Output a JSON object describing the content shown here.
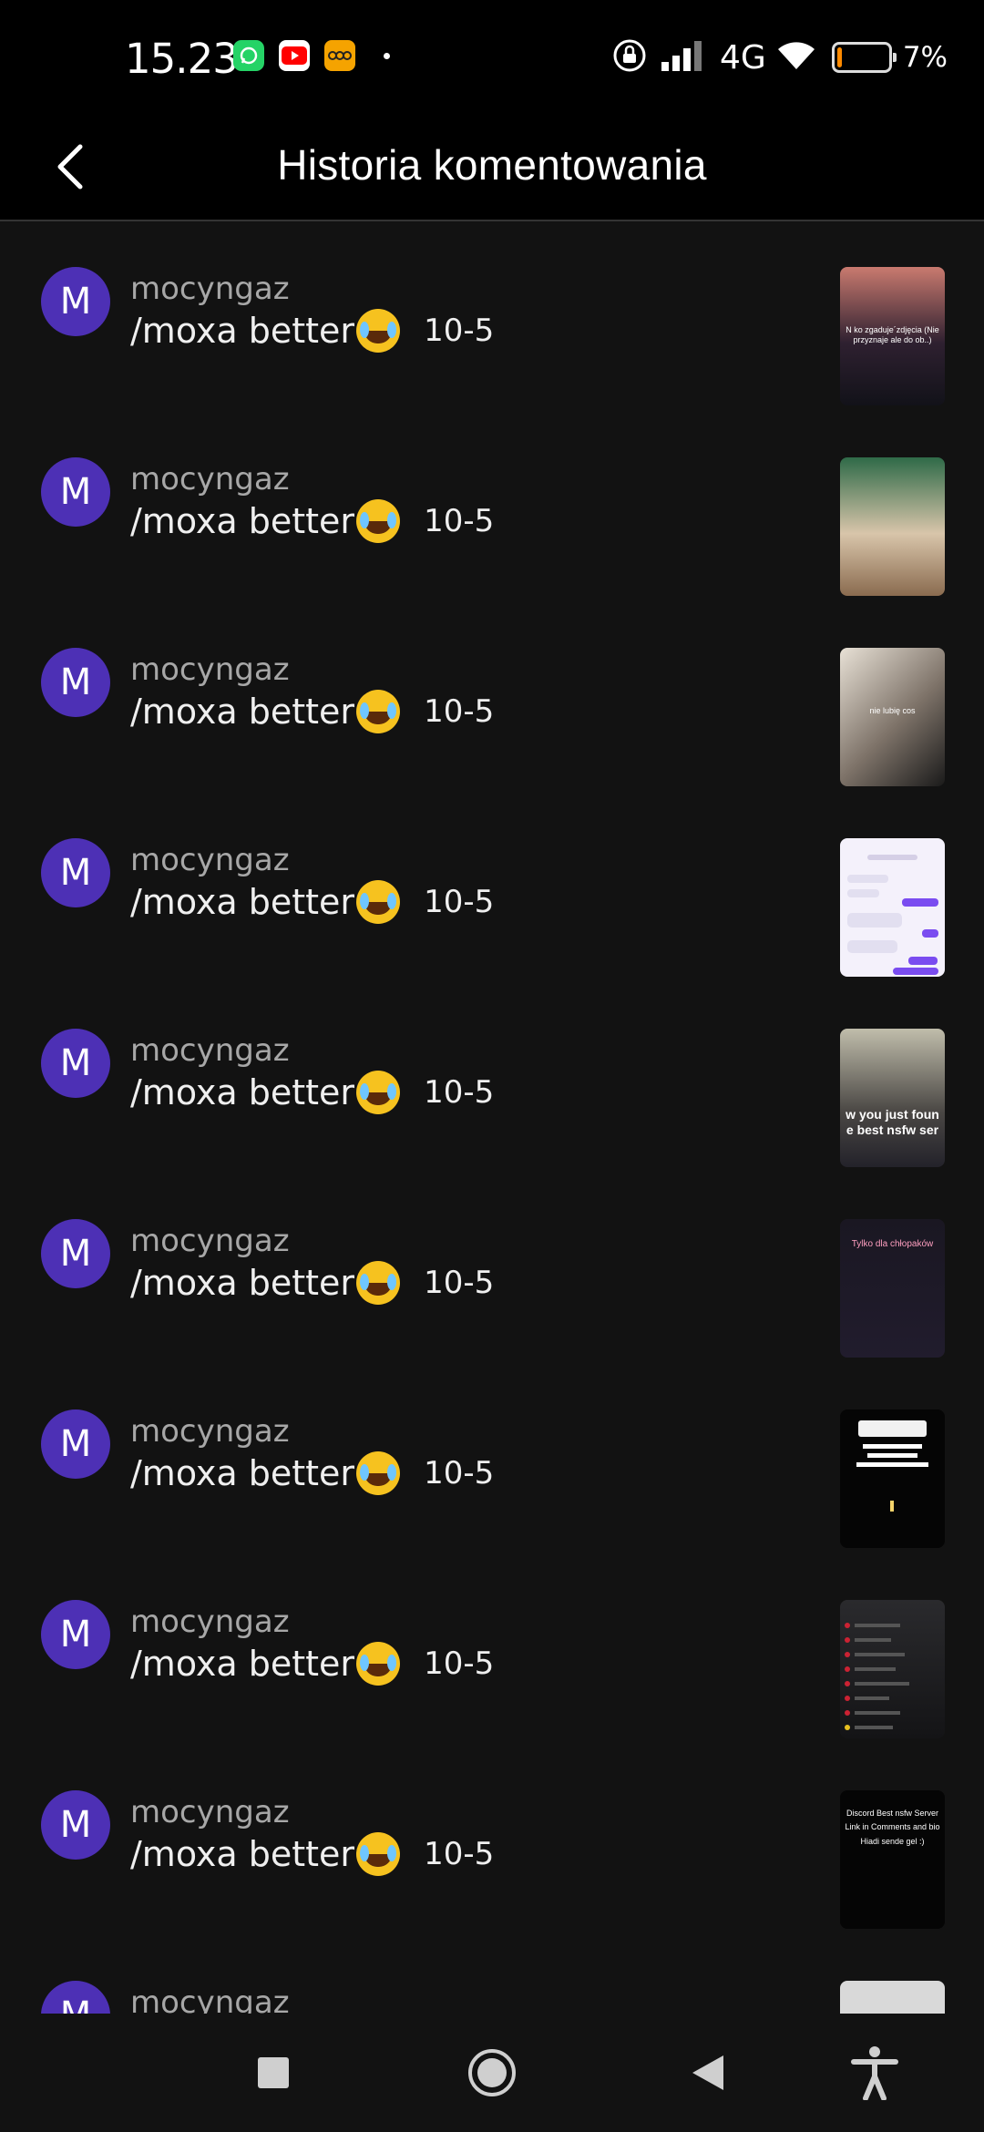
{
  "status_bar": {
    "time": "15.23",
    "network": "4G",
    "battery_percent": "7%",
    "battery_level": 0.07,
    "notification_icons": [
      "whatsapp-icon",
      "youtube-icon",
      "app-icon"
    ]
  },
  "header": {
    "title": "Historia komentowania"
  },
  "comments": [
    {
      "avatar_letter": "M",
      "username": "mocyngaz",
      "text": "/moxa better",
      "date": "10-5",
      "thumb_text": "N ko zgadujе´zdjęcia (Nie przyznaje ale do ob..)"
    },
    {
      "avatar_letter": "M",
      "username": "mocyngaz",
      "text": "/moxa better",
      "date": "10-5",
      "thumb_text": ""
    },
    {
      "avatar_letter": "M",
      "username": "mocyngaz",
      "text": "/moxa better",
      "date": "10-5",
      "thumb_text": "nie lubię cos"
    },
    {
      "avatar_letter": "M",
      "username": "mocyngaz",
      "text": "/moxa better",
      "date": "10-5",
      "thumb_text": ""
    },
    {
      "avatar_letter": "M",
      "username": "mocyngaz",
      "text": "/moxa better",
      "date": "10-5",
      "thumb_text": "w you just foun e best nsfw ser"
    },
    {
      "avatar_letter": "M",
      "username": "mocyngaz",
      "text": "/moxa better",
      "date": "10-5",
      "thumb_text": "Tylko dla chłopaków"
    },
    {
      "avatar_letter": "M",
      "username": "mocyngaz",
      "text": "/moxa better",
      "date": "10-5",
      "thumb_text": ""
    },
    {
      "avatar_letter": "M",
      "username": "mocyngaz",
      "text": "/moxa better",
      "date": "10-5",
      "thumb_text": ""
    },
    {
      "avatar_letter": "M",
      "username": "mocyngaz",
      "text": "/moxa better",
      "date": "10-5",
      "thumb_text": "Discord Best nsfw Server Link in Comments and bio Hiadi sende gel :)"
    },
    {
      "avatar_letter": "M",
      "username": "mocyngaz",
      "text": "",
      "date": "",
      "thumb_text": ""
    }
  ],
  "nav": {
    "buttons": [
      "recents-button",
      "home-button",
      "back-nav-button",
      "accessibility-button"
    ]
  }
}
